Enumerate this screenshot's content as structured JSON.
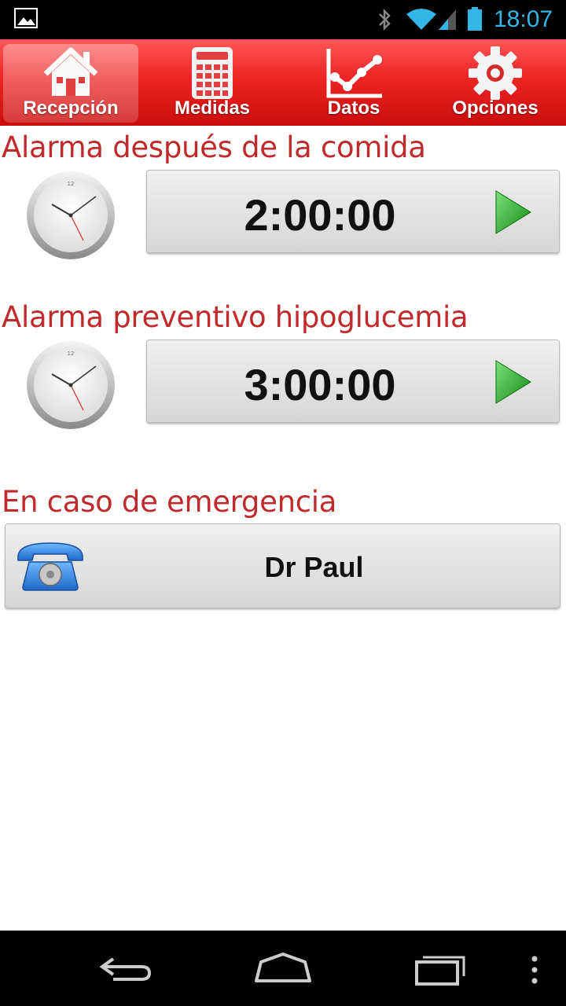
{
  "status_bar": {
    "time": "18:07",
    "icons": [
      "gallery-icon",
      "bluetooth-icon",
      "wifi-icon",
      "signal-icon",
      "battery-icon"
    ],
    "clock_color": "#33b5e5"
  },
  "tabs": [
    {
      "label": "Recepción",
      "icon": "home-icon",
      "active": true
    },
    {
      "label": "Medidas",
      "icon": "calculator-icon",
      "active": false
    },
    {
      "label": "Datos",
      "icon": "chart-icon",
      "active": false
    },
    {
      "label": "Opciones",
      "icon": "gear-icon",
      "active": false
    }
  ],
  "sections": {
    "alarm_after_meal": {
      "title": "Alarma después de la comida",
      "timer": "2:00:00"
    },
    "alarm_hypoglycemia": {
      "title": "Alarma preventivo hipoglucemia",
      "timer": "3:00:00"
    },
    "emergency": {
      "title": "En caso de emergencia",
      "contact": "Dr Paul"
    }
  },
  "colors": {
    "accent_red": "#e82020",
    "title_red": "#c02a2a"
  },
  "nav_bar": {
    "buttons": [
      "back-icon",
      "home-icon",
      "recent-apps-icon",
      "menu-icon"
    ]
  }
}
